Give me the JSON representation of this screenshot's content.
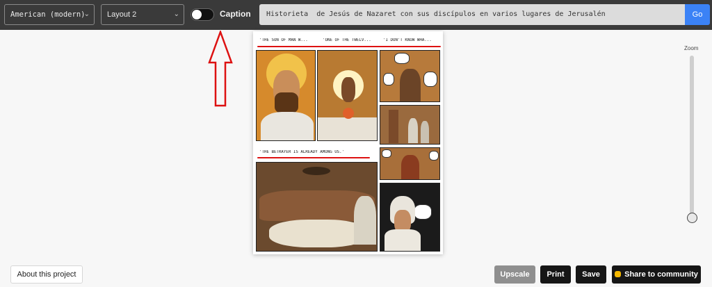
{
  "toolbar": {
    "style_select": "American (modern)",
    "layout_select": "Layout 2",
    "caption_label": "Caption",
    "caption_on": true,
    "prompt_value": "Historieta  de Jesús de Nazaret con sus discípulos en varios lugares de Jerusalén",
    "go_label": "Go"
  },
  "comic": {
    "captions": [
      "'THE SON OF MAN W...",
      "'ONE OF THE TWELV...",
      "'I DON'T KNOW WHA...",
      "'THE BETRAYER IS ALREADY AMONG US.'"
    ]
  },
  "zoom": {
    "label": "Zoom"
  },
  "footer": {
    "about_label": "About this project",
    "upscale_label": "Upscale",
    "print_label": "Print",
    "save_label": "Save",
    "share_label": "Share to community"
  },
  "colors": {
    "accent": "#3b82f6",
    "annotation": "#d11"
  }
}
